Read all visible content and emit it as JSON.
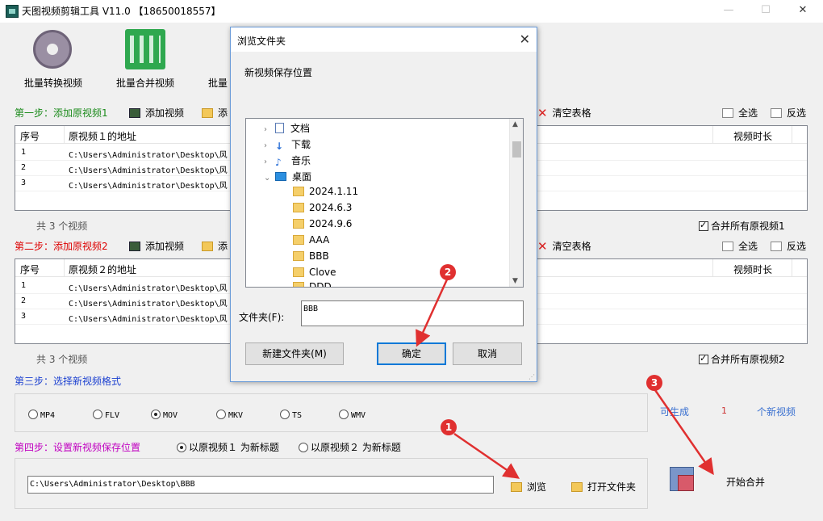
{
  "app": {
    "title": "天图视频剪辑工具 V11.0 【18650018557】",
    "window_controls": {
      "minimize": "—",
      "maximize": "☐",
      "close": "✕"
    }
  },
  "toolbar": {
    "batch_convert": "批量转换视频",
    "batch_merge": "批量合并视频",
    "batch_third": "批量"
  },
  "step1": {
    "label": "第一步：添加原视频1",
    "add_video": "添加视频",
    "add_folder": "添",
    "clear_table": "清空表格",
    "select_all": "全选",
    "invert": "反选",
    "columns": {
      "index": "序号",
      "path": "原视频１的地址",
      "duration": "视频时长"
    },
    "rows": [
      {
        "index": "1",
        "path": "C:\\Users\\Administrator\\Desktop\\风"
      },
      {
        "index": "2",
        "path": "C:\\Users\\Administrator\\Desktop\\风"
      },
      {
        "index": "3",
        "path": "C:\\Users\\Administrator\\Desktop\\风"
      }
    ],
    "count": "共 3 个视频",
    "merge_all": "合并所有原视频1"
  },
  "step2": {
    "label": "第二步：添加原视频2",
    "add_video": "添加视频",
    "add_folder": "添",
    "clear_table": "清空表格",
    "select_all": "全选",
    "invert": "反选",
    "columns": {
      "index": "序号",
      "path": "原视频２的地址",
      "duration": "视频时长"
    },
    "rows": [
      {
        "index": "1",
        "path": "C:\\Users\\Administrator\\Desktop\\风"
      },
      {
        "index": "2",
        "path": "C:\\Users\\Administrator\\Desktop\\风"
      },
      {
        "index": "3",
        "path": "C:\\Users\\Administrator\\Desktop\\风"
      }
    ],
    "count": "共 3 个视频",
    "merge_all": "合并所有原视频2"
  },
  "step3": {
    "label": "第三步：选择新视频格式",
    "formats": [
      "MP4",
      "FLV",
      "MOV",
      "MKV",
      "TS",
      "WMV"
    ],
    "selected": "MOV",
    "can_generate": "可生成",
    "generate_count": "1",
    "new_videos": "个新视频"
  },
  "step4": {
    "label": "第四步：设置新视频保存位置",
    "title_opt1": "以原视频１ 为新标题",
    "title_opt2": "以原视频２ 为新标题",
    "path": "C:\\Users\\Administrator\\Desktop\\BBB",
    "browse": "浏览",
    "open_folder": "打开文件夹",
    "start_merge": "开始合并"
  },
  "dialog": {
    "title": "浏览文件夹",
    "prompt": "新视频保存位置",
    "tree": [
      {
        "label": "文档",
        "type": "doc"
      },
      {
        "label": "下载",
        "type": "download"
      },
      {
        "label": "音乐",
        "type": "music"
      },
      {
        "label": "桌面",
        "type": "desktop"
      },
      {
        "label": "2024.1.11",
        "type": "folder"
      },
      {
        "label": "2024.6.3",
        "type": "folder"
      },
      {
        "label": "2024.9.6",
        "type": "folder"
      },
      {
        "label": "AAA",
        "type": "folder"
      },
      {
        "label": "BBB",
        "type": "folder"
      },
      {
        "label": "Clove",
        "type": "folder"
      },
      {
        "label": "DDD",
        "type": "folder"
      }
    ],
    "selected": "BBB",
    "folder_label": "文件夹(F):",
    "folder_value": "BBB",
    "new_folder": "新建文件夹(M)",
    "ok": "确定",
    "cancel": "取消"
  },
  "annotations": {
    "badge1": "1",
    "badge2": "2",
    "badge3": "3",
    "color": "#e03030"
  }
}
